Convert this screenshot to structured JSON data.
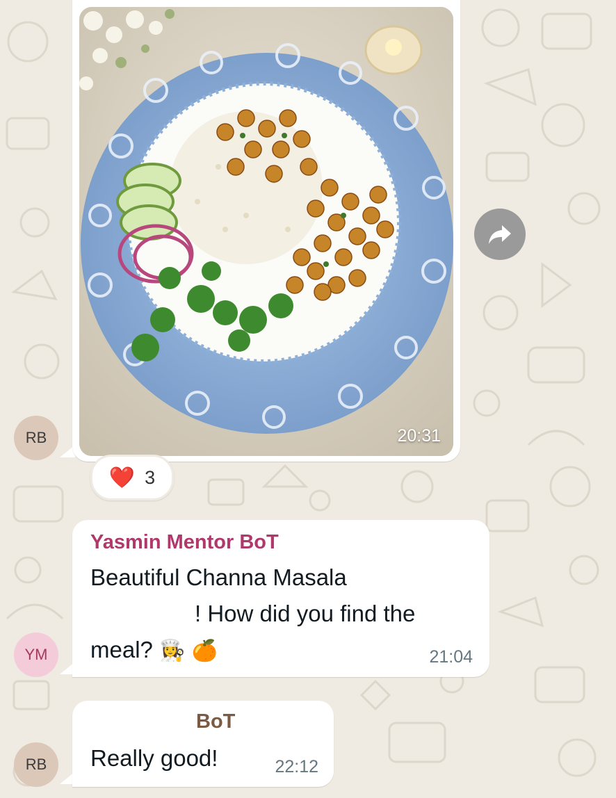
{
  "messages": [
    {
      "avatar": "RB",
      "type": "image",
      "image_description": "plate of channa masala with rice, cucumber, onion and coriander",
      "time": "20:31",
      "reaction": {
        "emoji": "❤️",
        "count": "3"
      }
    },
    {
      "avatar": "YM",
      "sender": "Yasmin Mentor BoT",
      "sender_color": "#b0396b",
      "line1": "Beautiful Channa Masala",
      "line2": "! How did you find the",
      "line3": "meal?",
      "emojis": [
        "👩‍🍳",
        "🍊"
      ],
      "time": "21:04"
    },
    {
      "avatar": "RB",
      "sender": "BoT",
      "sender_color": "#7b5a43",
      "text": "Really good!",
      "time": "22:12"
    }
  ],
  "forward_icon": "share-forward-icon",
  "colors": {
    "background": "#efeae2",
    "bubble": "#ffffff",
    "forward": "#9a9a9a"
  }
}
